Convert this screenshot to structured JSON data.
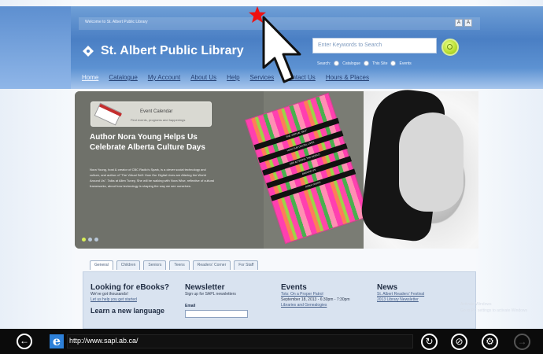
{
  "site": {
    "welcome": "Welcome to St. Albert Public Library",
    "textsize": [
      "A",
      "A"
    ],
    "name": "St. Albert Public Library",
    "search": {
      "placeholder": "Enter Keywords to Search",
      "options": [
        "Search:",
        "Catalogue",
        "This Site",
        "Events"
      ]
    },
    "nav": [
      "Home",
      "Catalogue",
      "My Account",
      "About Us",
      "Help",
      "Services",
      "Contact Us",
      "Hours & Places"
    ]
  },
  "hero": {
    "event_card": {
      "title": "Event Calendar",
      "subtitle": "Find events, programs and happenings"
    },
    "title": "Author Nora Young Helps Us Celebrate Alberta Culture Days",
    "body": "Nora Young, host & creator of CBC Radio's Spark, is a clever social technology and culture, and author of \"The Virtual Self: How Our Digital Lives are Altering the World Around Us\". Talks at Allen Tuney, She will be walking with Nora Wise, reflective of cultural frameworks, about how technology is shaping the way we see ourselves.",
    "book_bands": [
      "THE VIRTUAL SELF",
      "HOW OUR DIGITAL LIVES",
      "ARE ALTERING THE WORLD",
      "AROUND US",
      "NORA YOUNG"
    ]
  },
  "tabs": [
    "General",
    "Children",
    "Seniors",
    "Teens",
    "Readers' Corner",
    "For Staff"
  ],
  "columns": {
    "ebooks": {
      "title": "Looking for eBooks?",
      "text": "We've got thousands!",
      "link": "Let us help you get started",
      "lang_title": "Learn a new language"
    },
    "newsletter": {
      "title": "Newsletter",
      "text": "Sign up for SAPL newsletters",
      "email_label": "Email"
    },
    "events": {
      "title": "Events",
      "link": "Tots: On a Proper Patrol",
      "date": "September 18, 2013 - 6:30pm - 7:30pm",
      "link2": "Libraries and Genealogies"
    },
    "news": {
      "title": "News",
      "link": "St. Albert Readers' Festival",
      "link2": "2013 Library Newsletter"
    }
  },
  "watermark": [
    "Activate Windows",
    "Go to PC settings to activate Windows"
  ],
  "browser": {
    "url": "http://www.sapl.ab.ca/",
    "url_host": "sapl.ab.ca",
    "buttons": [
      "↻",
      "⊘",
      "⚙",
      "→"
    ]
  },
  "colors": {
    "brand_blue": "#4a7fc4",
    "search_go": "#b7dd2d",
    "taskbar": "#0b0b0b",
    "annotation_star": "#ee1111"
  }
}
